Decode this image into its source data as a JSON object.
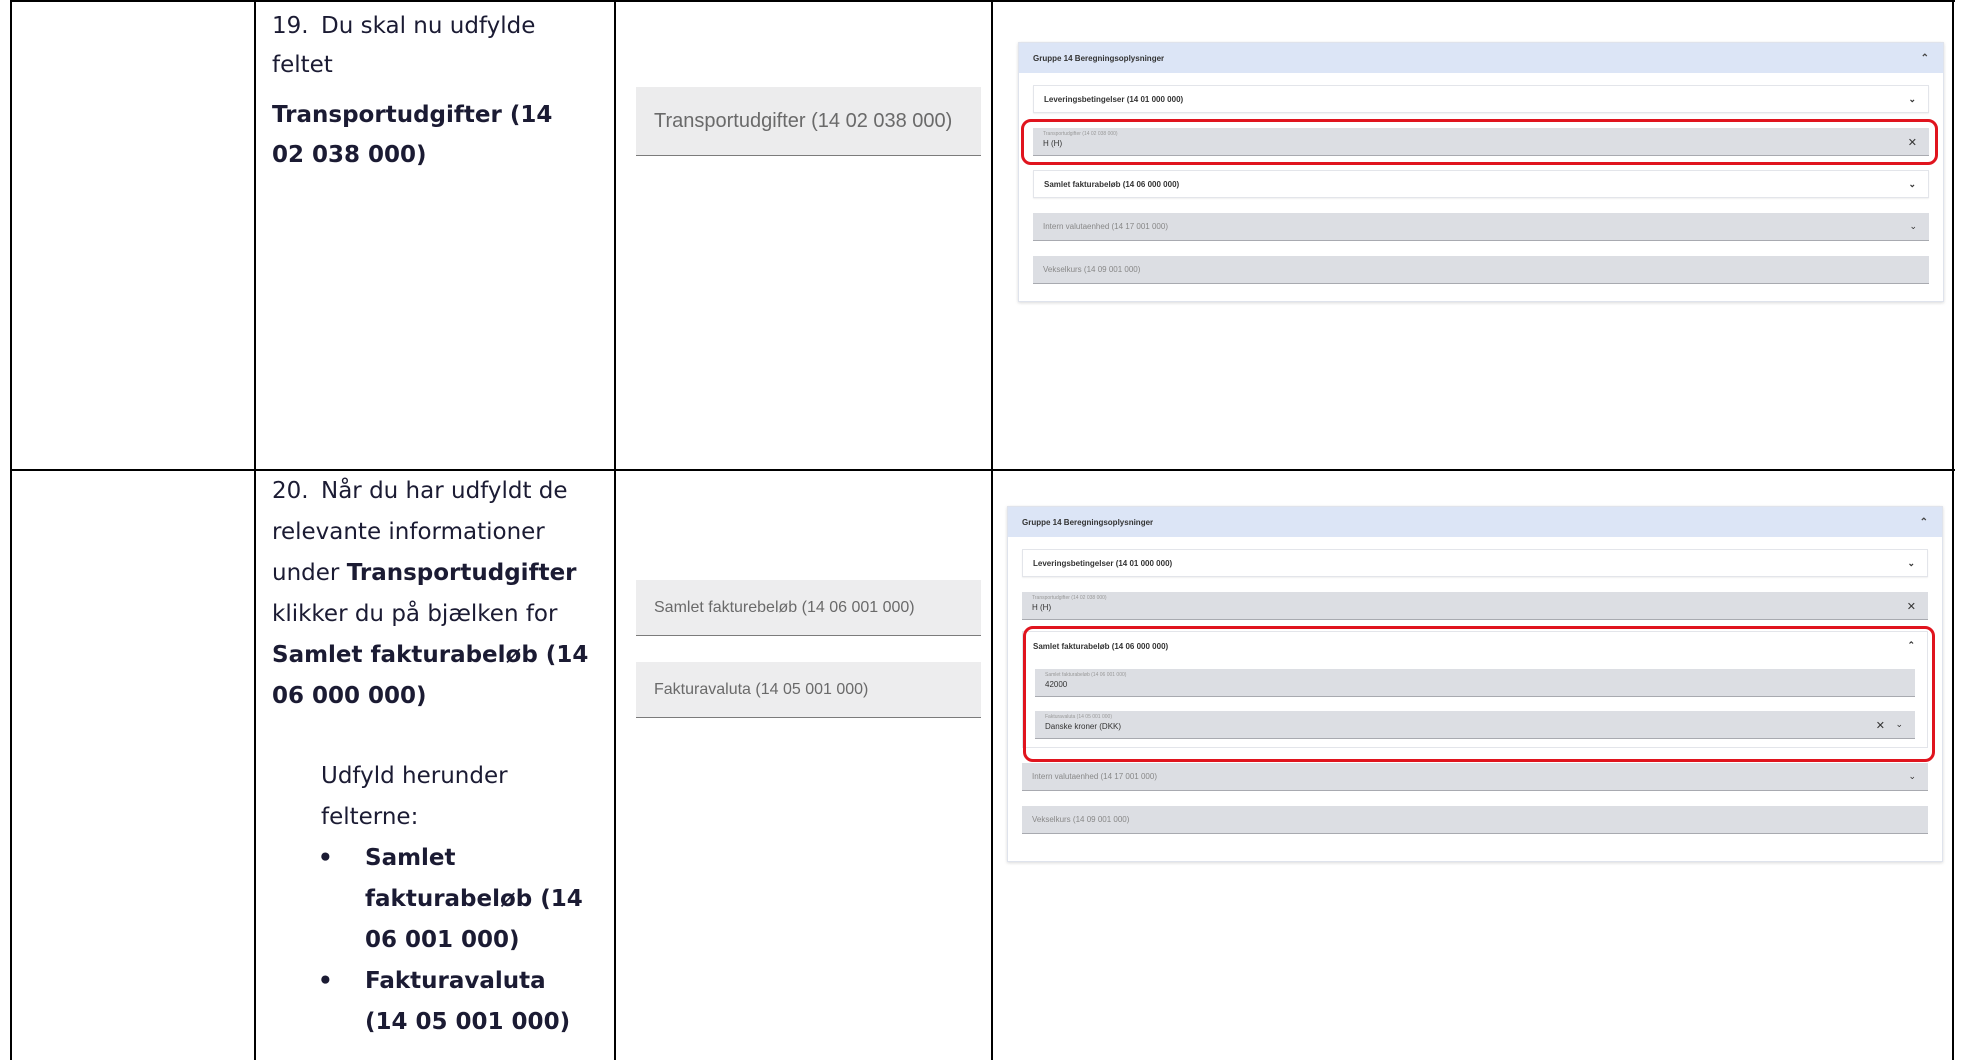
{
  "step19": {
    "number": "19.",
    "line1": "Du skal nu udfylde feltet",
    "bold": "Transportudgifter (14 02 038 000)"
  },
  "step20": {
    "number": "20.",
    "text1": "Når du har udfyldt de relevante informationer under",
    "bold1": "Transportudgifter",
    "text2": "klikker du på bjælken for",
    "bold2": "Samlet fakturabeløb (14 06 000 000)",
    "text3": "Udfyld herunder felterne:",
    "bullets": [
      "Samlet fakturabeløb (14 06 001 000)",
      "Fakturavaluta (14 05 001 000)"
    ]
  },
  "illustration19": {
    "field_label": "Transportudgifter (14 02 038 000)"
  },
  "illustration20": {
    "field1_label": "Samlet fakturebeløb (14 06 001 000)",
    "field2_label": "Fakturavaluta (14 05 001 000)"
  },
  "screen1": {
    "group_title": "Gruppe 14 Beregningsoplysninger",
    "levering": "Leveringsbetingelser (14 01 000 000)",
    "transport_label": "Transportudgifter (14 02 038 000)",
    "transport_value": "H (H)",
    "samlet": "Samlet fakturabeløb (14 06 000 000)",
    "intern": "Intern valutaenhed (14 17 001 000)",
    "vekselkurs": "Vekselkurs (14 09 001 000)"
  },
  "screen2": {
    "group_title": "Gruppe 14 Beregningsoplysninger",
    "levering": "Leveringsbetingelser (14 01 000 000)",
    "transport_label": "Transportudgifter (14 02 038 000)",
    "transport_value": "H (H)",
    "samlet": "Samlet fakturabeløb (14 06 000 000)",
    "samlet_field_label": "Samlet fakturabeløb (14 06 001 000)",
    "samlet_field_value": "42000",
    "valuta_label": "Fakturavaluta (14 05 001 000)",
    "valuta_value": "Danske kroner (DKK)",
    "intern": "Intern valutaenhed (14 17 001 000)",
    "vekselkurs": "Vekselkurs (14 09 001 000)"
  },
  "icons": {
    "close": "close-icon",
    "chevron_up": "chevron-up-icon",
    "chevron_down": "chevron-down-icon"
  }
}
